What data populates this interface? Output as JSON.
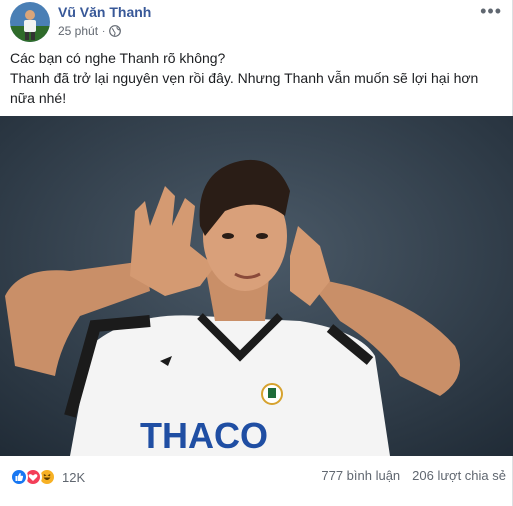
{
  "post": {
    "author": "Vũ Văn Thanh",
    "time": "25 phút",
    "separator": "·",
    "privacy_icon": "globe-icon",
    "more_label": "•••",
    "text_lines": [
      "Các bạn có nghe Thanh rõ không?",
      "Thanh đã trở lại nguyên vẹn rồi đây. Nhưng Thanh vẫn muốn sẽ lợi hại hơn nữa nhé!"
    ],
    "jersey_text": "THACO"
  },
  "footer": {
    "reaction_icons": [
      "like-icon",
      "love-icon",
      "haha-icon"
    ],
    "reaction_count": "12K",
    "comments": "777 bình luận",
    "shares": "206 lượt chia sẻ"
  },
  "colors": {
    "author_link": "#385898",
    "like": "#1877f2",
    "love": "#f33e58",
    "haha": "#f7b125"
  }
}
